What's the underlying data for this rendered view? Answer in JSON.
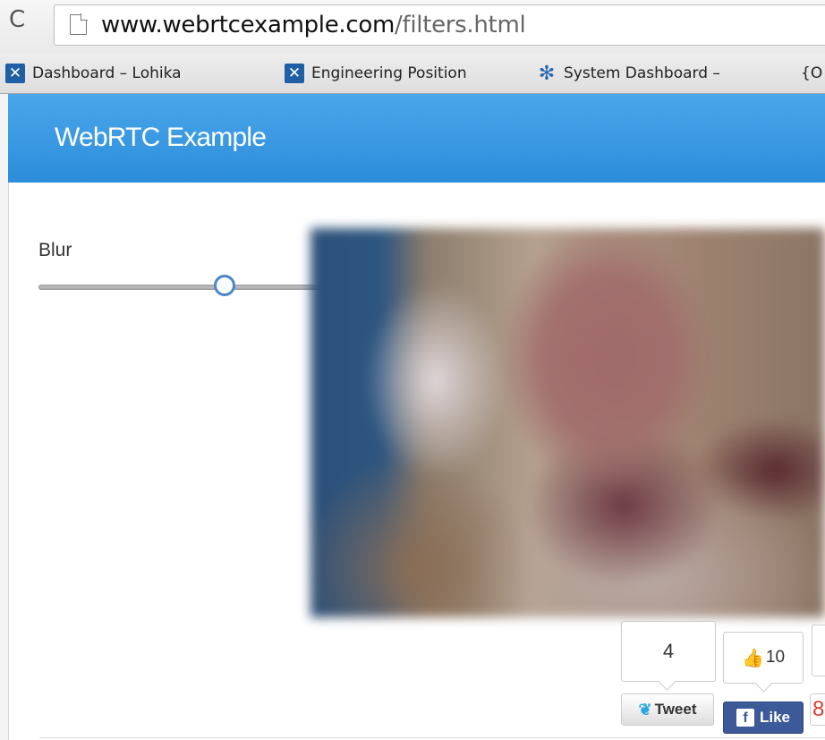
{
  "browser": {
    "url_domain": "www.webrtcexample.com",
    "url_path": "/filters.html",
    "reload_icon": "C",
    "bookmarks": [
      {
        "label": "Dashboard – Lohika",
        "icon": "x-icon"
      },
      {
        "label": "Engineering Position",
        "icon": "x-icon"
      },
      {
        "label": "System Dashboard –",
        "icon": "star-icon"
      },
      {
        "label": "{O",
        "icon": ""
      }
    ]
  },
  "navbar": {
    "brand": "WebRTC Example",
    "color": "#3b9ae3"
  },
  "filters": {
    "blur_label": "Blur",
    "blur_value_fraction": 0.58
  },
  "social": {
    "tweet_count": "4",
    "tweet_label": "Tweet",
    "like_count": "10",
    "like_label": "Like",
    "gplus_glyph": "8"
  }
}
